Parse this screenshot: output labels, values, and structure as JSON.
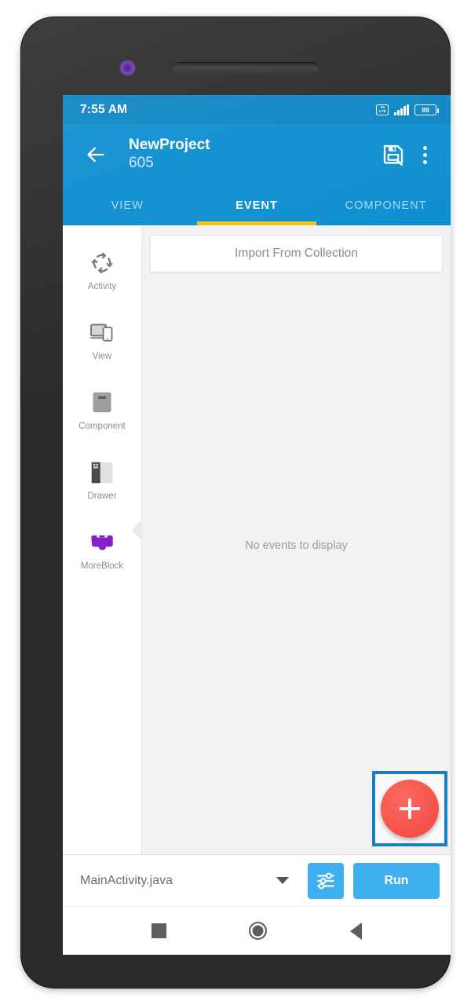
{
  "status_bar": {
    "time": "7:55 AM",
    "volte_top": "Vo",
    "volte_bottom": "LTE",
    "battery_level": "89",
    "signal_icon": "signal-bars-icon",
    "volte_icon": "volte-icon",
    "battery_icon": "battery-icon"
  },
  "app_bar": {
    "back_icon": "arrow-left-icon",
    "title": "NewProject",
    "subtitle": "605",
    "save_icon": "save-floppy-icon",
    "overflow_icon": "more-vertical-icon"
  },
  "tabs": {
    "items": [
      {
        "label": "VIEW",
        "active": false
      },
      {
        "label": "EVENT",
        "active": true
      },
      {
        "label": "COMPONENT",
        "active": false
      }
    ],
    "active_indicator_color": "#f5c01f"
  },
  "sidebar": {
    "items": [
      {
        "label": "Activity",
        "icon": "recycle-arrows-icon",
        "selected": false
      },
      {
        "label": "View",
        "icon": "devices-icon",
        "selected": false
      },
      {
        "label": "Component",
        "icon": "component-square-icon",
        "selected": false
      },
      {
        "label": "Drawer",
        "icon": "drawer-icon",
        "selected": false
      },
      {
        "label": "MoreBlock",
        "icon": "puzzle-block-icon",
        "selected": true
      }
    ]
  },
  "content": {
    "import_button_label": "Import From Collection",
    "empty_state_text": "No events to display",
    "fab": {
      "icon": "plus-icon",
      "color": "#f6544c",
      "highlight_border_color": "#1a7fc1"
    }
  },
  "bottom_bar": {
    "file_value": "MainActivity.java",
    "dropdown_icon": "chevron-down-icon",
    "settings_icon": "sliders-icon",
    "run_label": "Run",
    "accent_color": "#3fb0ef"
  },
  "nav_bar": {
    "recents_icon": "square-recents-icon",
    "home_icon": "circle-home-icon",
    "back_icon": "triangle-back-icon"
  },
  "device": {
    "camera_icon": "front-camera-icon",
    "speaker_icon": "earpiece-speaker-icon"
  },
  "theme": {
    "status_bar_color": "#0d86c4",
    "app_bar_color": "#0d8ecf",
    "content_bg": "#f2f2f2"
  }
}
